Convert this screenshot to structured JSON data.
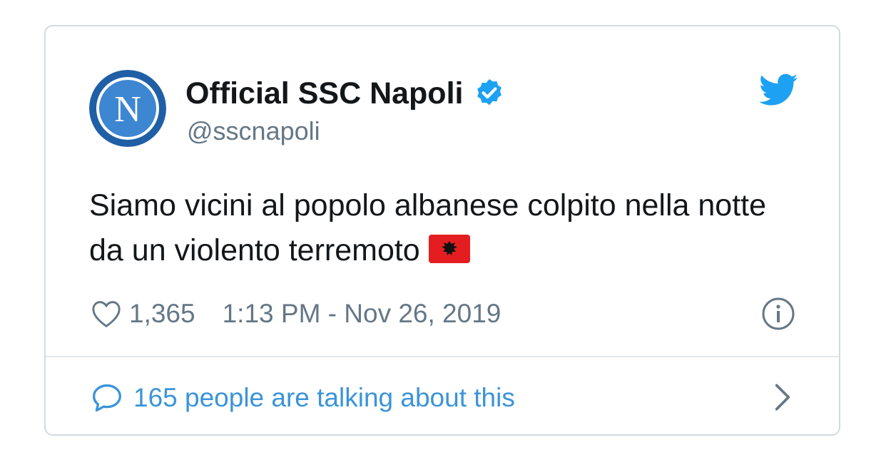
{
  "author": {
    "display_name": "Official SSC Napoli",
    "handle": "@sscnapoli",
    "avatar_letter": "N",
    "verified": true
  },
  "tweet": {
    "text": "Siamo vicini al popolo albanese colpito nella notte da un violento terremoto",
    "emoji": "albania-flag"
  },
  "meta": {
    "likes": "1,365",
    "timestamp": "1:13 PM - Nov 26, 2019"
  },
  "footer": {
    "talking": "165 people are talking about this"
  },
  "colors": {
    "text": "#14171a",
    "secondary": "#657786",
    "link": "#3b94d9",
    "verified": "#1da1f2",
    "twitter_blue": "#1da1f2",
    "border": "#d3dae0",
    "flag_red": "#e41e20"
  },
  "icons": [
    "twitter-bird-icon",
    "verified-badge-icon",
    "heart-icon",
    "info-icon",
    "speech-bubble-icon",
    "chevron-right-icon"
  ]
}
